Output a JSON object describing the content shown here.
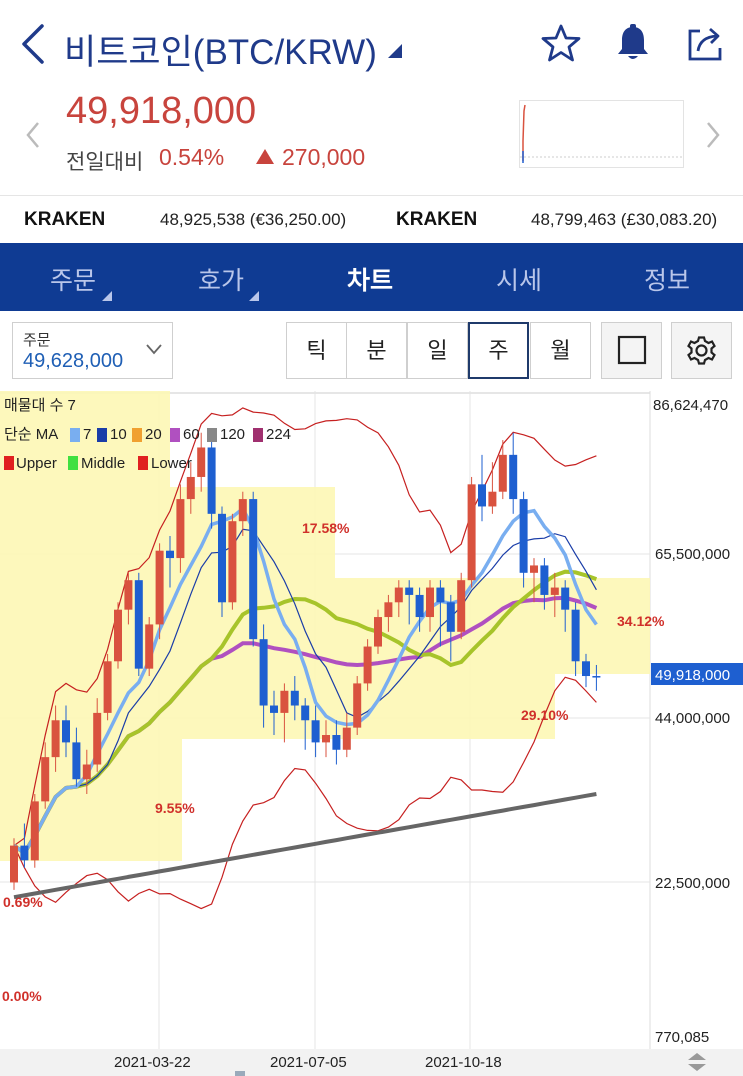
{
  "header": {
    "title": "비트코인(BTC/KRW)",
    "price": "49,918,000",
    "compare_label": "전일대비",
    "compare_pct": "0.54%",
    "compare_amount": "270,000"
  },
  "exchanges": [
    {
      "name": "KRAKEN",
      "value": "48,925,538 (€36,250.00)"
    },
    {
      "name": "KRAKEN",
      "value": "48,799,463 (£30,083.20)"
    }
  ],
  "tabs": [
    {
      "label": "주문",
      "has_menu": true
    },
    {
      "label": "호가",
      "has_menu": true
    },
    {
      "label": "차트",
      "active": true
    },
    {
      "label": "시세"
    },
    {
      "label": "정보"
    }
  ],
  "order": {
    "label": "주문",
    "value": "49,628,000"
  },
  "periods": [
    "틱",
    "분",
    "일",
    "주",
    "월"
  ],
  "selected_period": "주",
  "legend": {
    "volume_profile": "매물대 수 7",
    "ma_label": "단순 MA",
    "ma_items": [
      {
        "label": "7",
        "color": "#79aef0"
      },
      {
        "label": "10",
        "color": "#1a3da8"
      },
      {
        "label": "20",
        "color": "#f0a030"
      },
      {
        "label": "60",
        "color": "#b050c0"
      },
      {
        "label": "120",
        "color": "#888888"
      },
      {
        "label": "224",
        "color": "#a0306f"
      }
    ],
    "bands": [
      {
        "label": "Upper",
        "color": "#e02020"
      },
      {
        "label": "Middle",
        "color": "#40e040"
      },
      {
        "label": "Lower",
        "color": "#e02020"
      }
    ]
  },
  "colors": {
    "up": "#d9523f",
    "down": "#1e5fd0",
    "ma_short": "#79aef0",
    "ma_mid": "#a7c42a",
    "ma_long": "#b050c0",
    "ma_slow": "#666666",
    "band": "#c62020",
    "accent": "#0f3b93"
  },
  "chart_data": {
    "type": "candlestick",
    "y_ticks": [
      "86,624,470",
      "65,500,000",
      "44,000,000",
      "22,500,000",
      "770,085"
    ],
    "x_ticks": [
      "2021-03-22",
      "2021-07-05",
      "2021-10-18"
    ],
    "current_price_label": "49,918,000",
    "profile_labels": [
      "17.58%",
      "9.55%",
      "0.69%",
      "0.00%",
      "34.12%",
      "29.10%"
    ],
    "ylim": [
      770085,
      86624470
    ],
    "candles": [
      [
        22000000,
        27000000,
        21000000,
        28000000
      ],
      [
        27000000,
        25000000,
        24000000,
        30000000
      ],
      [
        25000000,
        33000000,
        24000000,
        34000000
      ],
      [
        33000000,
        39000000,
        32000000,
        41000000
      ],
      [
        39000000,
        44000000,
        37000000,
        46000000
      ],
      [
        44000000,
        41000000,
        39000000,
        46000000
      ],
      [
        41000000,
        36000000,
        35000000,
        43000000
      ],
      [
        36000000,
        38000000,
        34000000,
        40000000
      ],
      [
        38000000,
        45000000,
        37000000,
        47000000
      ],
      [
        45000000,
        52000000,
        44000000,
        53000000
      ],
      [
        52000000,
        59000000,
        51000000,
        60000000
      ],
      [
        59000000,
        63000000,
        57000000,
        64000000
      ],
      [
        63000000,
        51000000,
        50000000,
        64000000
      ],
      [
        51000000,
        57000000,
        50000000,
        58000000
      ],
      [
        57000000,
        67000000,
        55000000,
        68000000
      ],
      [
        67000000,
        66000000,
        62000000,
        69000000
      ],
      [
        66000000,
        74000000,
        64000000,
        76000000
      ],
      [
        74000000,
        77000000,
        72000000,
        79000000
      ],
      [
        77000000,
        81000000,
        75000000,
        83000000
      ],
      [
        81000000,
        72000000,
        70000000,
        82000000
      ],
      [
        72000000,
        60000000,
        58000000,
        73000000
      ],
      [
        60000000,
        71000000,
        59000000,
        72000000
      ],
      [
        71000000,
        74000000,
        69000000,
        75000000
      ],
      [
        74000000,
        55000000,
        54000000,
        75000000
      ],
      [
        55000000,
        46000000,
        43000000,
        57000000
      ],
      [
        46000000,
        45000000,
        42000000,
        48000000
      ],
      [
        45000000,
        48000000,
        41000000,
        49000000
      ],
      [
        48000000,
        46000000,
        44000000,
        50000000
      ],
      [
        46000000,
        44000000,
        40000000,
        47000000
      ],
      [
        44000000,
        41000000,
        39000000,
        46000000
      ],
      [
        41000000,
        42000000,
        39000000,
        44000000
      ],
      [
        42000000,
        40000000,
        38000000,
        44000000
      ],
      [
        40000000,
        43000000,
        39000000,
        45000000
      ],
      [
        43000000,
        49000000,
        42000000,
        50000000
      ],
      [
        49000000,
        54000000,
        48000000,
        55000000
      ],
      [
        54000000,
        58000000,
        53000000,
        59000000
      ],
      [
        58000000,
        60000000,
        56000000,
        61000000
      ],
      [
        60000000,
        62000000,
        58000000,
        63000000
      ],
      [
        62000000,
        61000000,
        57000000,
        63000000
      ],
      [
        61000000,
        58000000,
        56000000,
        62000000
      ],
      [
        58000000,
        62000000,
        56000000,
        63000000
      ],
      [
        62000000,
        60000000,
        54000000,
        63000000
      ],
      [
        60000000,
        56000000,
        52000000,
        61000000
      ],
      [
        56000000,
        63000000,
        55000000,
        64000000
      ],
      [
        63000000,
        76000000,
        62000000,
        77000000
      ],
      [
        76000000,
        73000000,
        71000000,
        80000000
      ],
      [
        73000000,
        75000000,
        72000000,
        79000000
      ],
      [
        75000000,
        80000000,
        74000000,
        82000000
      ],
      [
        80000000,
        74000000,
        72000000,
        83000000
      ],
      [
        74000000,
        64000000,
        62000000,
        75000000
      ],
      [
        64000000,
        65000000,
        60000000,
        66000000
      ],
      [
        65000000,
        61000000,
        59000000,
        66000000
      ],
      [
        61000000,
        62000000,
        58000000,
        64000000
      ],
      [
        62000000,
        59000000,
        56000000,
        63000000
      ],
      [
        59000000,
        52000000,
        50000000,
        60000000
      ],
      [
        52000000,
        50000000,
        48500000,
        53000000
      ],
      [
        50000000,
        49918000,
        48000000,
        51500000
      ]
    ]
  }
}
